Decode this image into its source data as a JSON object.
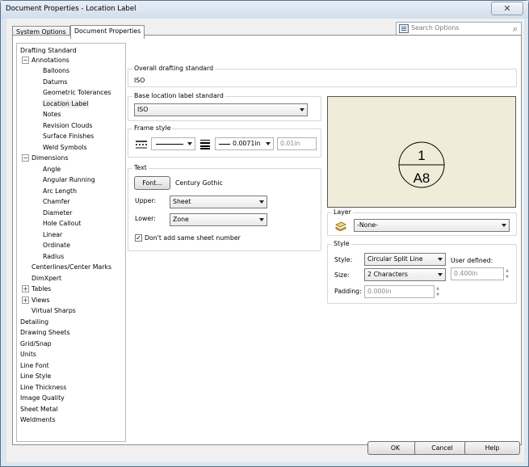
{
  "window": {
    "title": "Document Properties - Location Label",
    "close_glyph": "✕"
  },
  "tabs": [
    {
      "label": "System Options"
    },
    {
      "label": "Document Properties"
    }
  ],
  "search": {
    "placeholder": "Search Options",
    "icon": "options-list-icon",
    "search_icon": "magnifier-icon"
  },
  "tree": {
    "items": [
      "Drafting Standard",
      "Annotations",
      "Balloons",
      "Datums",
      "Geometric Tolerances",
      "Location Label",
      "Notes",
      "Revision Clouds",
      "Surface Finishes",
      "Weld Symbols",
      "Dimensions",
      "Angle",
      "Angular Running",
      "Arc Length",
      "Chamfer",
      "Diameter",
      "Hole Callout",
      "Linear",
      "Ordinate",
      "Radius",
      "Centerlines/Center Marks",
      "DimXpert",
      "Tables",
      "Views",
      "Virtual Sharps",
      "Detailing",
      "Drawing Sheets",
      "Grid/Snap",
      "Units",
      "Line Font",
      "Line Style",
      "Line Thickness",
      "Image Quality",
      "Sheet Metal",
      "Weldments"
    ],
    "expand_minus": "−",
    "expand_plus": "+",
    "selected": "Location Label"
  },
  "overall": {
    "label": "Overall drafting standard",
    "value": "ISO"
  },
  "base_std": {
    "label": "Base location label standard",
    "value": "ISO"
  },
  "frame": {
    "label": "Frame style",
    "thickness": "0.0071in",
    "custom": "0.01in"
  },
  "text": {
    "label": "Text",
    "font_button": "Font...",
    "font_name": "Century Gothic",
    "upper_label": "Upper:",
    "upper_value": "Sheet",
    "lower_label": "Lower:",
    "lower_value": "Zone",
    "checkbox_label": "Don't add same sheet number",
    "checkbox_checked": true
  },
  "preview": {
    "upper": "1",
    "lower": "A8"
  },
  "layer": {
    "label": "Layer",
    "value": "-None-"
  },
  "style": {
    "label": "Style",
    "style_label": "Style:",
    "style_value": "Circular Split Line",
    "size_label": "Size:",
    "size_value": "2 Characters",
    "user_defined_label": "User defined:",
    "user_defined_value": "0.400in",
    "padding_label": "Padding:",
    "padding_value": "0.000in"
  },
  "buttons": {
    "ok": "OK",
    "cancel": "Cancel",
    "help": "Help"
  }
}
